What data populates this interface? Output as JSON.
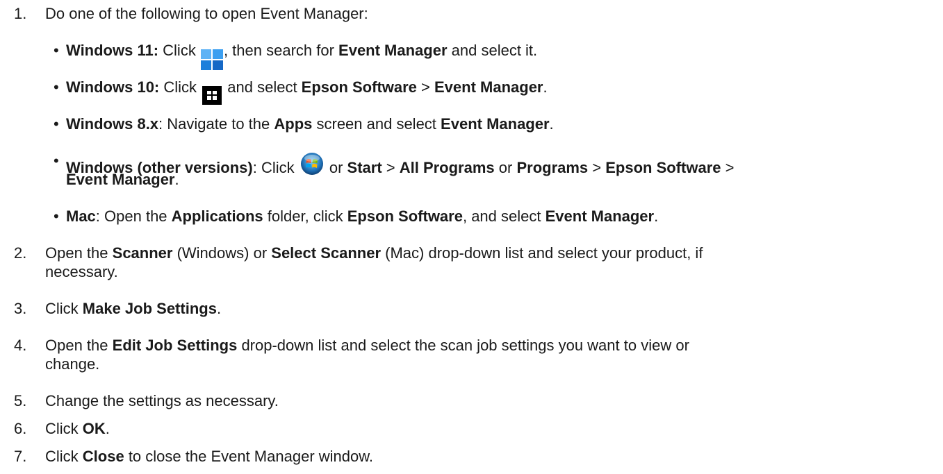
{
  "steps": [
    {
      "number": "1.",
      "parts": [
        "Do one of the following to open Event Manager:"
      ]
    },
    {
      "number": "2.",
      "parts": [
        "Open the ",
        "Scanner",
        " (Windows) or ",
        "Select Scanner",
        " (Mac) drop-down list and select your product, if",
        "necessary."
      ]
    },
    {
      "number": "3.",
      "parts": [
        "Click ",
        "Make Job Settings",
        "."
      ]
    },
    {
      "number": "4.",
      "parts": [
        "Open the ",
        "Edit Job Settings",
        " drop-down list and select the scan job settings you want to view or",
        "change."
      ]
    },
    {
      "number": "5.",
      "parts": [
        "Change the settings as necessary."
      ]
    },
    {
      "number": "6.",
      "parts": [
        "Click ",
        "OK",
        "."
      ]
    },
    {
      "number": "7.",
      "parts": [
        "Click ",
        "Close",
        " to close the Event Manager window."
      ]
    }
  ],
  "substeps": [
    {
      "bullet": "•",
      "parts": [
        "Windows 11:",
        " Click ",
        ", then search for ",
        "Event Manager",
        " and select it."
      ],
      "icon": "windows-11-start-icon"
    },
    {
      "bullet": "•",
      "parts": [
        "Windows 10:",
        " Click ",
        " and select ",
        "Epson Software",
        " > ",
        "Event Manager",
        "."
      ],
      "icon": "windows-10-start-icon"
    },
    {
      "bullet": "•",
      "parts": [
        "Windows 8.x",
        ": Navigate to the ",
        "Apps",
        " screen and select ",
        "Event Manager",
        "."
      ]
    },
    {
      "bullet": "•",
      "parts": [
        "Windows (other versions)",
        ": Click ",
        " or ",
        "Start",
        " > ",
        "All Programs",
        " or ",
        "Programs",
        " > ",
        "Epson Software",
        " >",
        "Event Manager",
        "."
      ],
      "icon": "windows-7-start-orb-icon"
    },
    {
      "bullet": "•",
      "parts": [
        "Mac",
        ": Open the ",
        "Applications",
        " folder, click ",
        "Epson Software",
        ", and select ",
        "Event Manager",
        "."
      ]
    }
  ],
  "colors": {
    "text": "#1a1a1a",
    "win11_blue": "#1a86e8"
  }
}
